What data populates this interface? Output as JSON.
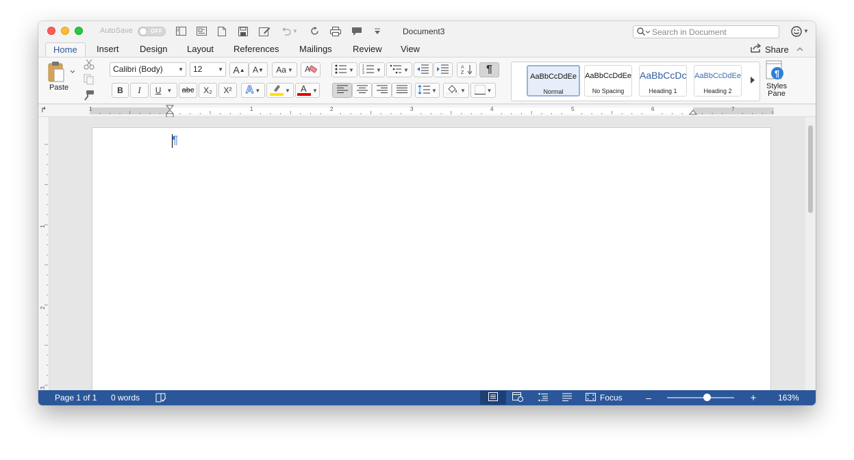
{
  "window": {
    "title": "Document3",
    "autosave_label": "AutoSave",
    "autosave_state": "OFF",
    "search_placeholder": "Search in Document"
  },
  "tabs": [
    {
      "label": "Home",
      "active": true
    },
    {
      "label": "Insert"
    },
    {
      "label": "Design"
    },
    {
      "label": "Layout"
    },
    {
      "label": "References"
    },
    {
      "label": "Mailings"
    },
    {
      "label": "Review"
    },
    {
      "label": "View"
    }
  ],
  "share_label": "Share",
  "ribbon": {
    "paste_label": "Paste",
    "font_name": "Calibri (Body)",
    "font_size": "12",
    "styles": [
      {
        "preview": "AaBbCcDdEe",
        "name": "Normal",
        "selected": true
      },
      {
        "preview": "AaBbCcDdEe",
        "name": "No Spacing"
      },
      {
        "preview": "AaBbCcDc",
        "name": "Heading 1"
      },
      {
        "preview": "AaBbCcDdEe",
        "name": "Heading 2"
      }
    ],
    "styles_pane_label": "Styles Pane",
    "bold": "B",
    "italic": "I",
    "underline": "U",
    "strike": "abc",
    "subscript": "X₂",
    "superscript": "X²",
    "pilcrow": "¶"
  },
  "ruler": {
    "numbers": [
      "1",
      "1",
      "2",
      "3",
      "4",
      "5",
      "6",
      "7"
    ],
    "vnumbers": [
      "1",
      "2",
      "3"
    ]
  },
  "document": {
    "pilcrow": "¶"
  },
  "status": {
    "page": "Page 1 of 1",
    "words": "0 words",
    "focus": "Focus",
    "zoom": "163%",
    "zoom_level": 0.6
  },
  "colors": {
    "accent": "#2b579a",
    "highlight": "#ffe100",
    "font_color": "#e00000",
    "pilcrow": "#3a7bd5"
  }
}
